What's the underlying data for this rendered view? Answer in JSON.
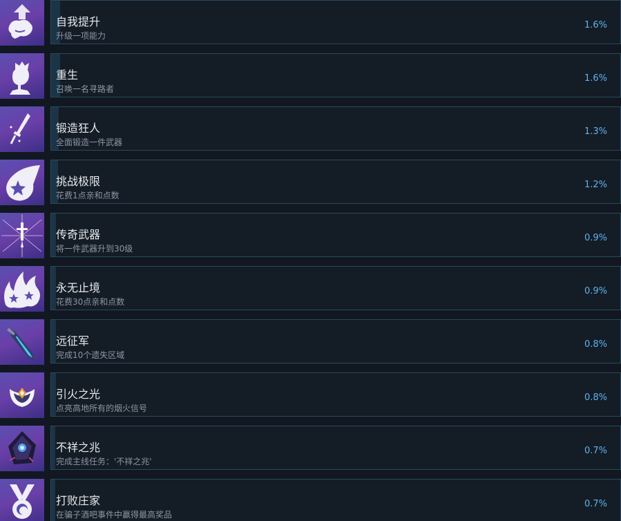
{
  "achievements": [
    {
      "title": "自我提升",
      "desc": "升级一项能力",
      "pct": "1.6%",
      "rate": 1.6,
      "icon": "arrow-up-fist-icon"
    },
    {
      "title": "重生",
      "desc": "召唤一名寻路者",
      "pct": "1.6%",
      "rate": 1.6,
      "icon": "head-silhouette-icon"
    },
    {
      "title": "锻造狂人",
      "desc": "全面锻造一件武器",
      "pct": "1.3%",
      "rate": 1.3,
      "icon": "sword-sparkle-icon"
    },
    {
      "title": "挑战极限",
      "desc": "花费1点亲和点数",
      "pct": "1.2%",
      "rate": 1.2,
      "icon": "flame-star-icon"
    },
    {
      "title": "传奇武器",
      "desc": "将一件武器升到30级",
      "pct": "0.9%",
      "rate": 0.9,
      "icon": "radiant-sword-icon"
    },
    {
      "title": "永无止境",
      "desc": "花费30点亲和点数",
      "pct": "0.9%",
      "rate": 0.9,
      "icon": "triple-flame-icon"
    },
    {
      "title": "远征军",
      "desc": "完成10个遗失区域",
      "pct": "0.8%",
      "rate": 0.8,
      "icon": "blue-blade-icon"
    },
    {
      "title": "引火之光",
      "desc": "点亮高地所有的烟火信号",
      "pct": "0.8%",
      "rate": 0.8,
      "icon": "beacon-emblem-icon"
    },
    {
      "title": "不祥之兆",
      "desc": "完成主线任务：'不祥之兆'",
      "pct": "0.7%",
      "rate": 0.7,
      "icon": "dark-crystal-icon"
    },
    {
      "title": "打败庄家",
      "desc": "在骗子酒吧事件中赢得最高奖品",
      "pct": "0.7%",
      "rate": 0.7,
      "icon": "medal-icon"
    }
  ]
}
